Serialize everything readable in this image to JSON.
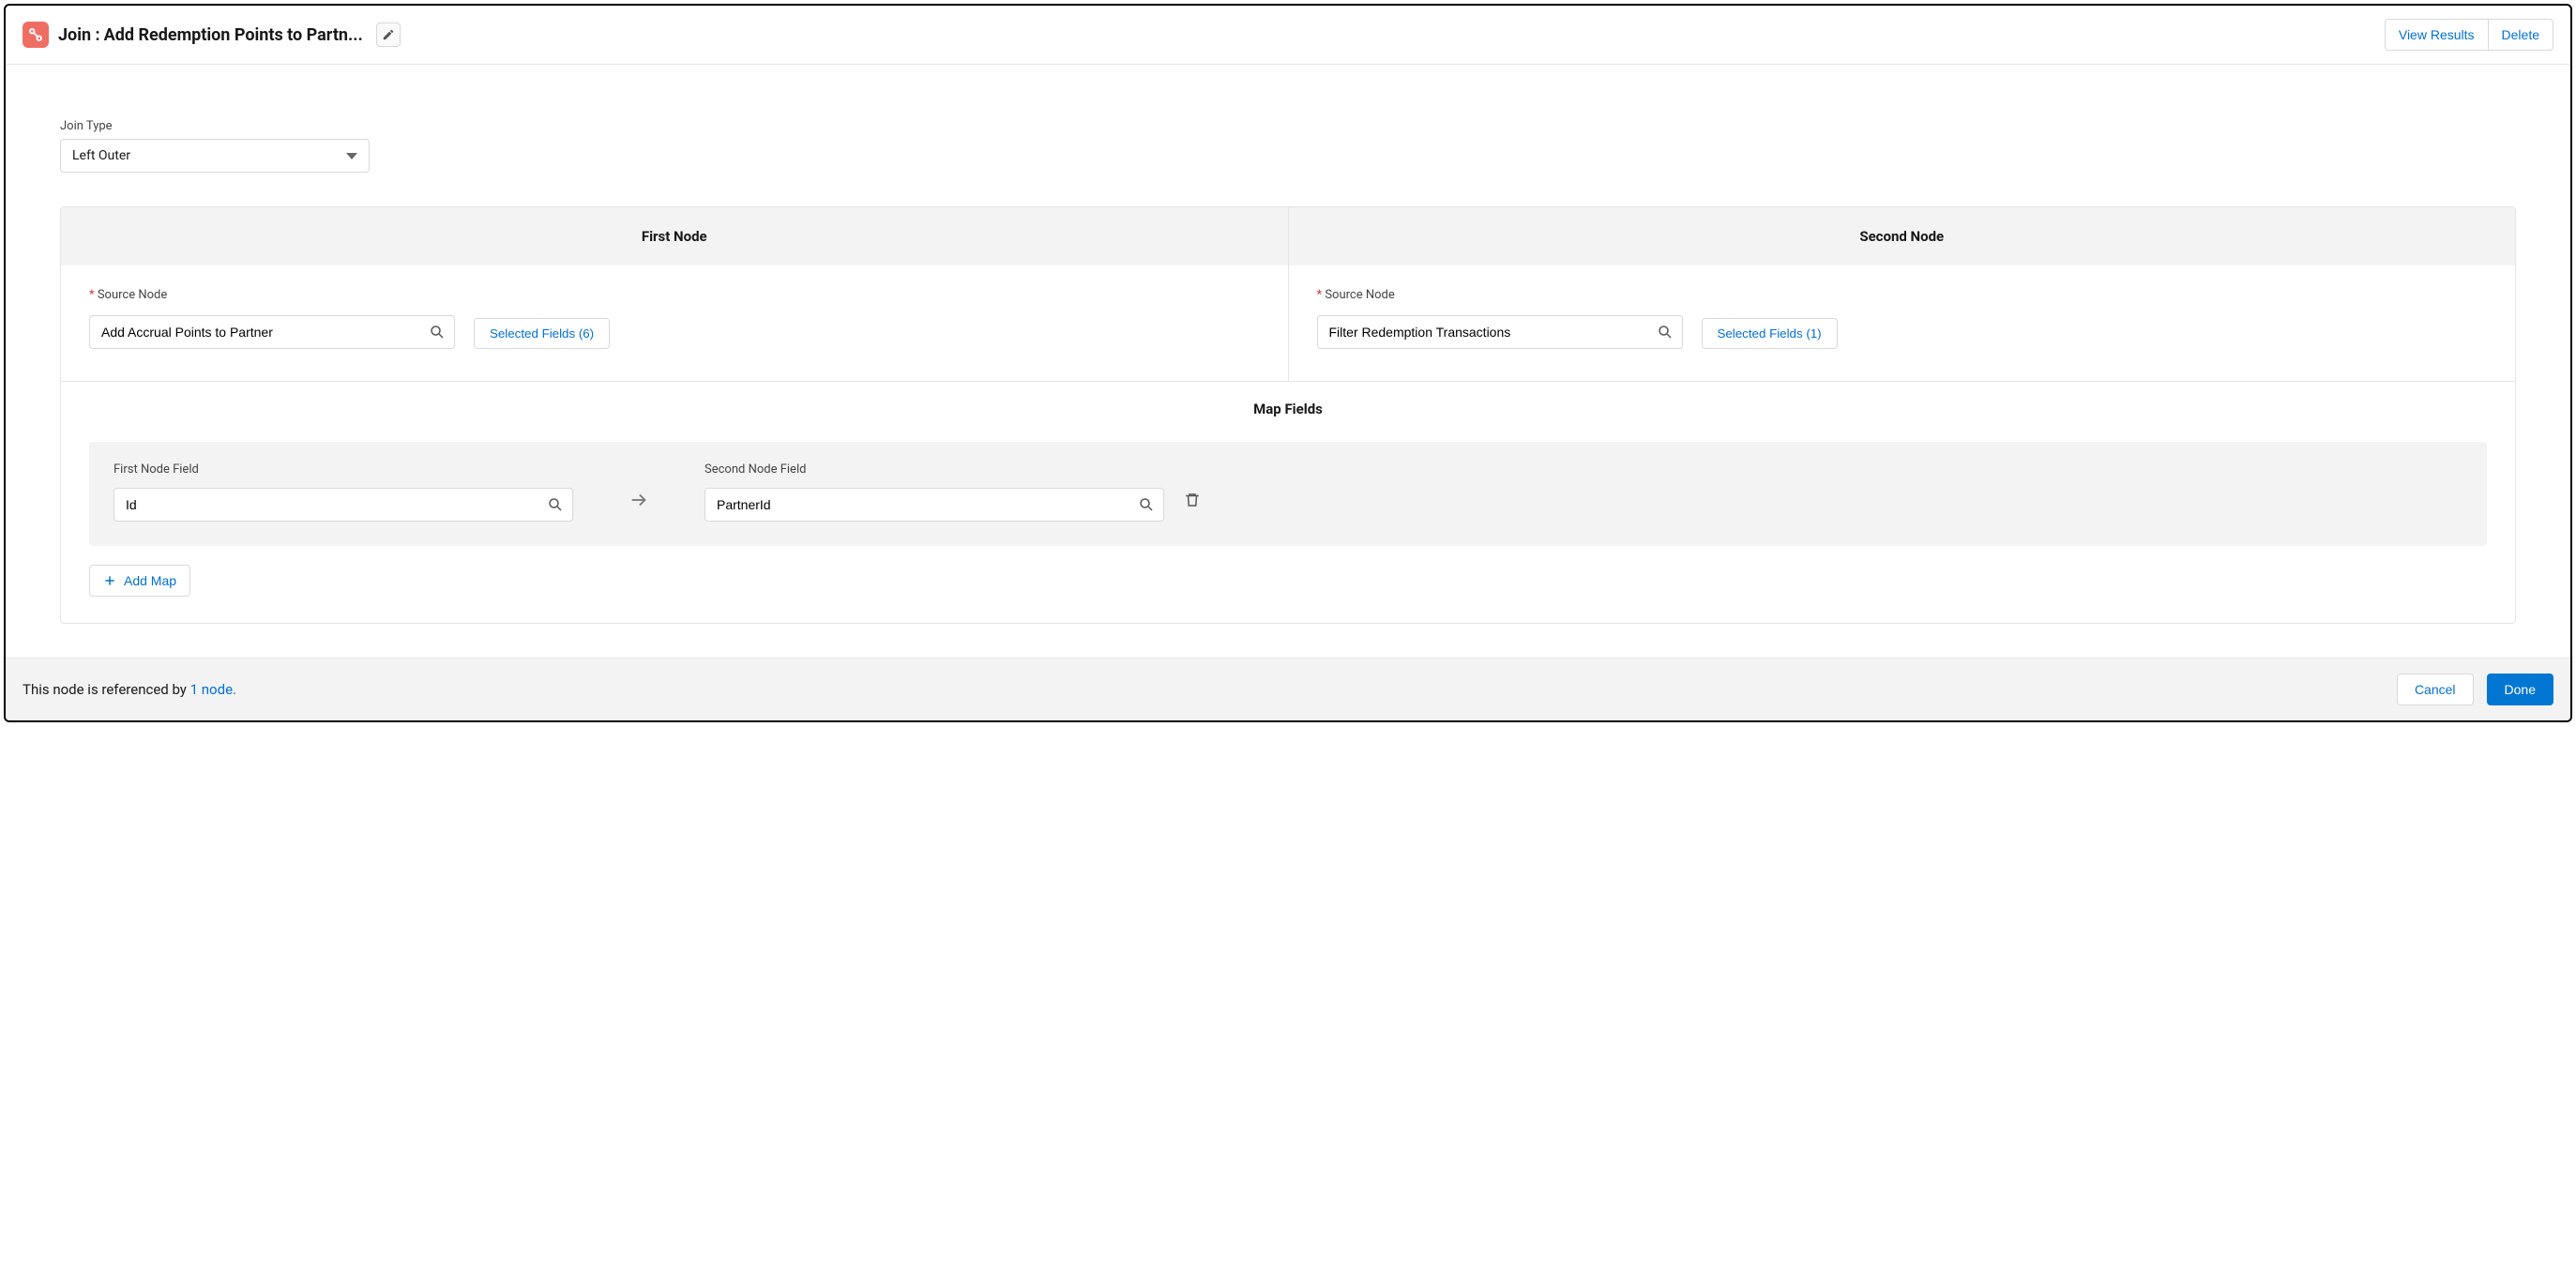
{
  "header": {
    "prefix": "Join :",
    "title": "Add Redemption Points to Partn...",
    "view_results_label": "View Results",
    "delete_label": "Delete"
  },
  "joinType": {
    "label": "Join Type",
    "value": "Left Outer"
  },
  "firstNode": {
    "title": "First Node",
    "sourceLabel": "Source Node",
    "sourceValue": "Add Accrual Points to Partner",
    "selectedFieldsLabel": "Selected Fields (6)"
  },
  "secondNode": {
    "title": "Second Node",
    "sourceLabel": "Source Node",
    "sourceValue": "Filter Redemption Transactions",
    "selectedFieldsLabel": "Selected Fields (1)"
  },
  "mapFields": {
    "title": "Map Fields",
    "firstNodeFieldLabel": "First Node Field",
    "firstNodeFieldValue": "Id",
    "secondNodeFieldLabel": "Second Node Field",
    "secondNodeFieldValue": "PartnerId",
    "addMapLabel": "Add Map"
  },
  "footer": {
    "refText": "This node is referenced by ",
    "refLink": "1 node.",
    "cancelLabel": "Cancel",
    "doneLabel": "Done"
  }
}
